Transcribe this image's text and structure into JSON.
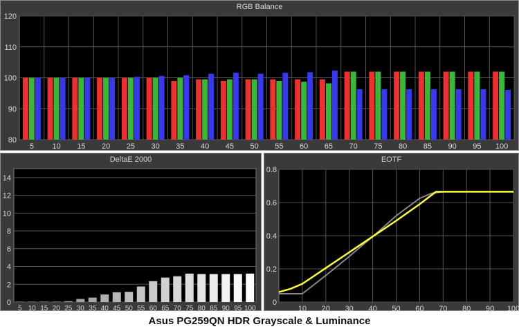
{
  "caption": "Asus PG259QN HDR Grayscale & Luminance",
  "colors": {
    "panel_bg": "#3a3a3a",
    "plot_bg": "#000000",
    "red": "#f03030",
    "green": "#38b838",
    "blue": "#3838f0",
    "target": "#ffff33",
    "measured": "#888888"
  },
  "chart_data": [
    {
      "type": "bar",
      "title": "RGB Balance",
      "categories": [
        "5",
        "10",
        "15",
        "20",
        "25",
        "30",
        "35",
        "40",
        "45",
        "50",
        "55",
        "60",
        "65",
        "70",
        "75",
        "80",
        "85",
        "90",
        "95",
        "100"
      ],
      "ylim": [
        80,
        120
      ],
      "yticks": [
        80,
        90,
        100,
        110,
        120
      ],
      "grid": true,
      "series": [
        {
          "color": "red",
          "values": [
            100,
            100,
            100,
            100,
            100,
            100,
            99,
            99.5,
            99,
            99.5,
            99.5,
            99.5,
            99.5,
            102,
            102,
            102,
            102,
            102,
            102,
            102
          ]
        },
        {
          "color": "green",
          "values": [
            100,
            100,
            100,
            100,
            100,
            100,
            100,
            99.5,
            99.5,
            99.5,
            99,
            98.7,
            98.2,
            102,
            102,
            102,
            102,
            102,
            102,
            102
          ]
        },
        {
          "color": "blue",
          "values": [
            100,
            100,
            100,
            100,
            100.3,
            100.6,
            100.8,
            101.3,
            101.6,
            101.3,
            101.6,
            101.8,
            102.3,
            96.3,
            96.3,
            96.3,
            96.3,
            96.3,
            96.3,
            96.1
          ]
        }
      ]
    },
    {
      "type": "bar",
      "title": "DeltaE 2000",
      "categories": [
        "5",
        "10",
        "15",
        "20",
        "25",
        "30",
        "35",
        "40",
        "45",
        "50",
        "55",
        "60",
        "65",
        "70",
        "75",
        "80",
        "85",
        "90",
        "95",
        "100"
      ],
      "values": [
        0.05,
        0.05,
        0.05,
        0.05,
        0.1,
        0.35,
        0.5,
        0.85,
        1.1,
        1.15,
        1.75,
        2.35,
        2.75,
        2.9,
        3.2,
        3.15,
        3.15,
        3.15,
        3.15,
        3.2
      ],
      "ylim": [
        0,
        15
      ],
      "yticks": [
        0,
        2,
        4,
        6,
        8,
        10,
        12,
        14
      ],
      "grid": true
    },
    {
      "type": "line",
      "title": "EOTF",
      "xlim": [
        0,
        100
      ],
      "ylim": [
        0,
        0.8
      ],
      "xticks": [
        10,
        20,
        30,
        40,
        50,
        60,
        70,
        80,
        90,
        100
      ],
      "yticks": [
        0,
        0.2,
        0.4,
        0.6,
        0.8
      ],
      "grid": true,
      "series": [
        {
          "color": "yellow",
          "x": [
            0,
            5,
            10,
            20,
            30,
            40,
            50,
            60,
            67,
            100
          ],
          "y": [
            0.06,
            0.08,
            0.11,
            0.205,
            0.3,
            0.395,
            0.49,
            0.59,
            0.665,
            0.665
          ]
        },
        {
          "color": "gray",
          "x": [
            0,
            5,
            10,
            20,
            30,
            40,
            50,
            60,
            65,
            70,
            100
          ],
          "y": [
            0.05,
            0.05,
            0.05,
            0.16,
            0.275,
            0.395,
            0.52,
            0.625,
            0.655,
            0.665,
            0.665
          ]
        }
      ]
    }
  ]
}
